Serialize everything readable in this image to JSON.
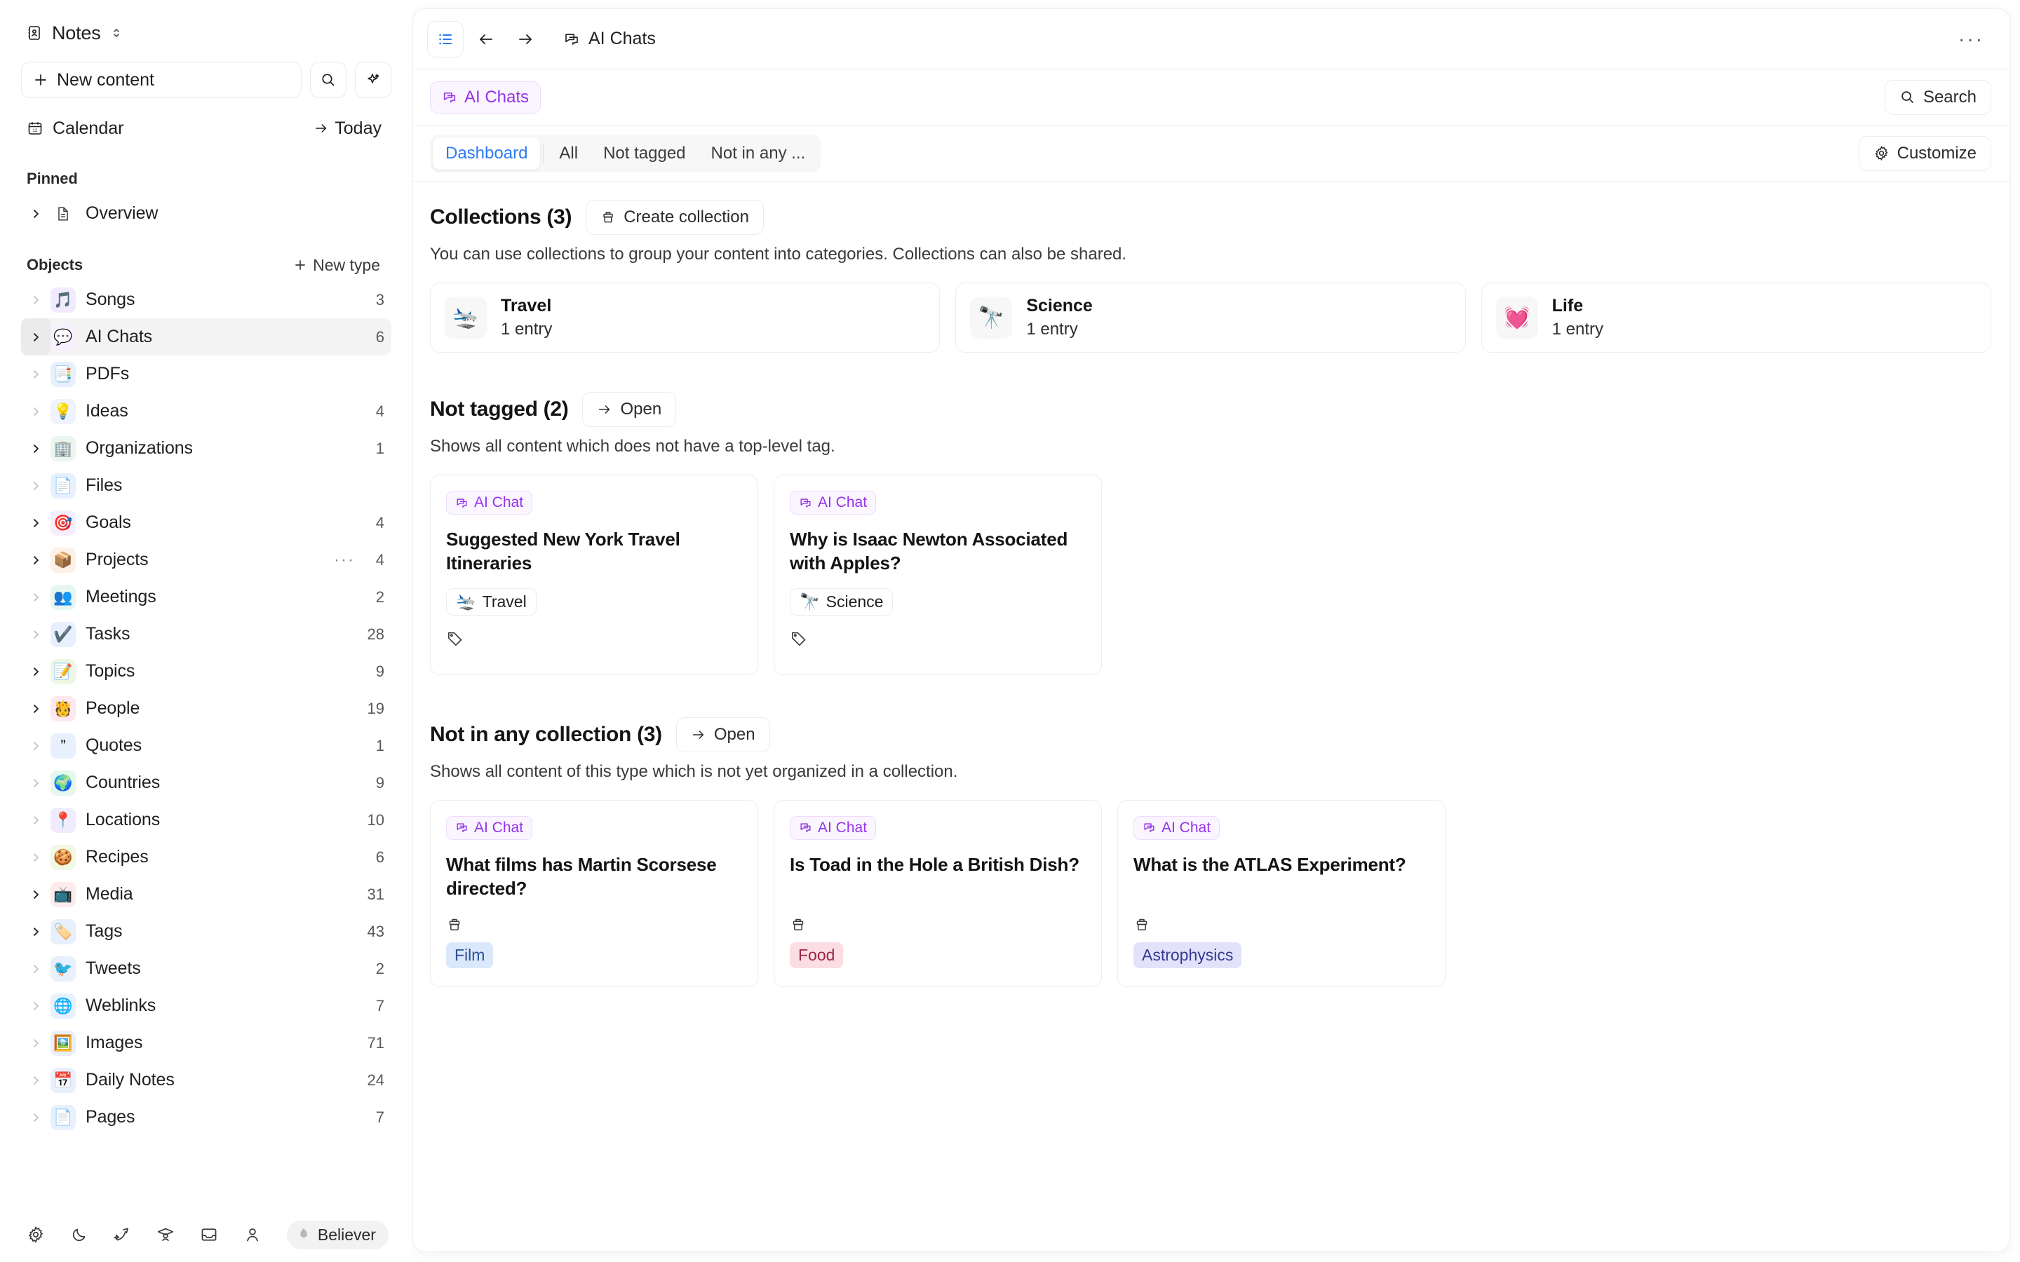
{
  "sidebar": {
    "workspace": {
      "name": "Notes",
      "icon": "address-book-icon"
    },
    "new_content_label": "New content",
    "search_icon": "search-icon",
    "ai_icon": "sparkles-icon",
    "calendar_label": "Calendar",
    "today_label": "Today",
    "pinned": {
      "title": "Pinned",
      "items": [
        {
          "label": "Overview",
          "icon": "document-icon",
          "count": ""
        }
      ]
    },
    "objects": {
      "title": "Objects",
      "new_type_label": "New type",
      "items": [
        {
          "label": "Songs",
          "emoji": "🎵",
          "bg": "#f1ecfd",
          "count": "3",
          "expandable": false,
          "active": false
        },
        {
          "label": "AI Chats",
          "emoji": "💬",
          "bg": "#f8f0ff",
          "count": "6",
          "expandable": true,
          "active": true
        },
        {
          "label": "PDFs",
          "emoji": "📑",
          "bg": "#e8f0fe",
          "count": "",
          "expandable": false,
          "active": false
        },
        {
          "label": "Ideas",
          "emoji": "💡",
          "bg": "#eef3fd",
          "count": "4",
          "expandable": false,
          "active": false
        },
        {
          "label": "Organizations",
          "emoji": "🏢",
          "bg": "#e9f7ee",
          "count": "1",
          "expandable": true,
          "active": false
        },
        {
          "label": "Files",
          "emoji": "📄",
          "bg": "#e8f0fe",
          "count": "",
          "expandable": false,
          "active": false
        },
        {
          "label": "Goals",
          "emoji": "🎯",
          "bg": "#f6eefd",
          "count": "4",
          "expandable": true,
          "active": false
        },
        {
          "label": "Projects",
          "emoji": "📦",
          "bg": "#fdf0e6",
          "count": "4",
          "expandable": true,
          "active": false,
          "dots": "···"
        },
        {
          "label": "Meetings",
          "emoji": "👥",
          "bg": "#e6f7f2",
          "count": "2",
          "expandable": false,
          "active": false
        },
        {
          "label": "Tasks",
          "emoji": "✔️",
          "bg": "#e8f0fe",
          "count": "28",
          "expandable": false,
          "active": false
        },
        {
          "label": "Topics",
          "emoji": "📝",
          "bg": "#eef7e3",
          "count": "9",
          "expandable": true,
          "active": false
        },
        {
          "label": "People",
          "emoji": "🫅",
          "bg": "#fce8ee",
          "count": "19",
          "expandable": true,
          "active": false
        },
        {
          "label": "Quotes",
          "emoji": "”",
          "bg": "#e8f0fe",
          "count": "1",
          "expandable": false,
          "active": false
        },
        {
          "label": "Countries",
          "emoji": "🌍",
          "bg": "#e6f7ee",
          "count": "9",
          "expandable": false,
          "active": false
        },
        {
          "label": "Locations",
          "emoji": "📍",
          "bg": "#f0ecfd",
          "count": "10",
          "expandable": false,
          "active": false
        },
        {
          "label": "Recipes",
          "emoji": "🍪",
          "bg": "#f1f8e3",
          "count": "6",
          "expandable": false,
          "active": false
        },
        {
          "label": "Media",
          "emoji": "📺",
          "bg": "#fdeaea",
          "count": "31",
          "expandable": true,
          "active": false
        },
        {
          "label": "Tags",
          "emoji": "🏷️",
          "bg": "#e8f0fe",
          "count": "43",
          "expandable": true,
          "active": false
        },
        {
          "label": "Tweets",
          "emoji": "🐦",
          "bg": "#e8f0fe",
          "count": "2",
          "expandable": false,
          "active": false
        },
        {
          "label": "Weblinks",
          "emoji": "🌐",
          "bg": "#e8f0fe",
          "count": "7",
          "expandable": false,
          "active": false
        },
        {
          "label": "Images",
          "emoji": "🖼️",
          "bg": "#e8f0fe",
          "count": "71",
          "expandable": false,
          "active": false
        },
        {
          "label": "Daily Notes",
          "emoji": "📅",
          "bg": "#e8f0fe",
          "count": "24",
          "expandable": false,
          "active": false
        },
        {
          "label": "Pages",
          "emoji": "📄",
          "bg": "#e8f0fe",
          "count": "7",
          "expandable": false,
          "active": false
        }
      ]
    },
    "footer": {
      "icons": [
        "gear-icon",
        "moon-icon",
        "magic-wand-icon",
        "graduation-cap-icon",
        "inbox-icon",
        "person-icon"
      ],
      "badge_label": "Believer",
      "badge_icon": "flame-icon"
    }
  },
  "topbar": {
    "list_icon": "list-view-icon",
    "back_icon": "arrow-left-icon",
    "forward_icon": "arrow-right-icon",
    "breadcrumb": "AI Chats",
    "breadcrumb_icon": "chat-icon",
    "overflow": "···"
  },
  "typebar": {
    "type_chip": "AI Chats",
    "type_chip_icon": "chat-icon",
    "search_label": "Search",
    "search_icon": "search-icon"
  },
  "tabbar": {
    "tabs": [
      {
        "label": "Dashboard",
        "active": true
      },
      {
        "label": "All",
        "active": false
      },
      {
        "label": "Not tagged",
        "active": false
      },
      {
        "label": "Not in any ...",
        "active": false
      }
    ],
    "customize_label": "Customize",
    "customize_icon": "gear-icon"
  },
  "collections_block": {
    "title": "Collections (3)",
    "action_label": "Create collection",
    "action_icon": "collection-icon",
    "description": "You can use collections to group your content into categories. Collections can also be shared.",
    "cards": [
      {
        "emoji": "🛬",
        "name": "Travel",
        "entries": "1 entry"
      },
      {
        "emoji": "🔭",
        "name": "Science",
        "entries": "1 entry"
      },
      {
        "emoji": "💓",
        "name": "Life",
        "entries": "1 entry"
      }
    ]
  },
  "not_tagged_block": {
    "title": "Not tagged (2)",
    "action_label": "Open",
    "action_icon": "arrow-right-icon",
    "description": "Shows all content which does not have a top-level tag.",
    "cards": [
      {
        "chip": "AI Chat",
        "title": "Suggested New York Travel Itineraries",
        "collection": "Travel",
        "collection_emoji": "🛬",
        "footer_icon": "tag-icon"
      },
      {
        "chip": "AI Chat",
        "title": "Why is Isaac Newton Associated with Apples?",
        "collection": "Science",
        "collection_emoji": "🔭",
        "footer_icon": "tag-icon"
      }
    ]
  },
  "not_in_collection_block": {
    "title": "Not in any collection (3)",
    "action_label": "Open",
    "action_icon": "arrow-right-icon",
    "description": "Shows all content of this type which is not yet organized in a collection.",
    "cards": [
      {
        "chip": "AI Chat",
        "title": "What films has Martin Scorsese directed?",
        "icon": "collection-icon",
        "tag": "Film",
        "tag_class": "tag-film"
      },
      {
        "chip": "AI Chat",
        "title": "Is Toad in the Hole a British Dish?",
        "icon": "collection-icon",
        "tag": "Food",
        "tag_class": "tag-food"
      },
      {
        "chip": "AI Chat",
        "title": "What is the ATLAS Experiment?",
        "icon": "collection-icon",
        "tag": "Astrophysics",
        "tag_class": "tag-astro"
      }
    ]
  },
  "colors": {
    "accent_purple": "#9333ea",
    "accent_blue": "#2b7bf4",
    "border": "#ededed",
    "text": "#141414"
  }
}
